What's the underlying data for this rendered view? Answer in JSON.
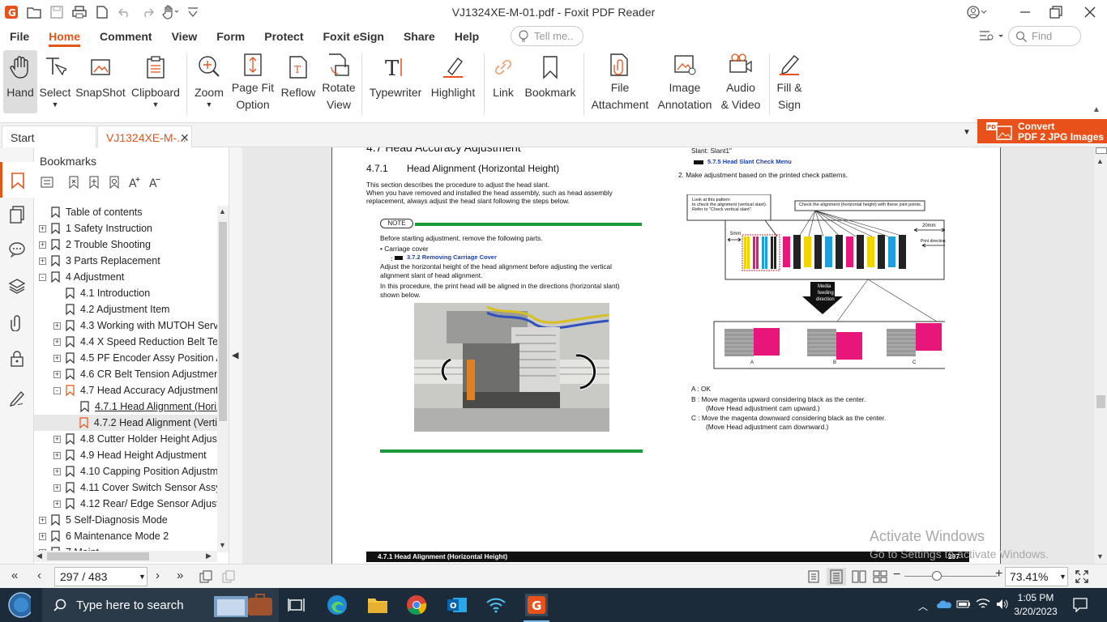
{
  "window": {
    "title": "VJ1324XE-M-01.pdf - Foxit PDF Reader"
  },
  "menu": [
    "File",
    "Home",
    "Comment",
    "View",
    "Form",
    "Protect",
    "Foxit eSign",
    "Share",
    "Help"
  ],
  "menu_active": "Home",
  "tell_me": {
    "placeholder": "Tell me.."
  },
  "find": {
    "placeholder": "Find"
  },
  "ribbon": {
    "hand": "Hand",
    "select": "Select",
    "snapshot": "SnapShot",
    "clipboard": "Clipboard",
    "zoom": "Zoom",
    "pagefit1": "Page Fit",
    "pagefit2": "Option",
    "reflow": "Reflow",
    "rotate1": "Rotate",
    "rotate2": "View",
    "typewriter": "Typewriter",
    "highlight": "Highlight",
    "link": "Link",
    "bookmark": "Bookmark",
    "file1": "File",
    "file2": "Attachment",
    "image1": "Image",
    "image2": "Annotation",
    "audio1": "Audio",
    "audio2": "& Video",
    "fill1": "Fill &",
    "fill2": "Sign"
  },
  "tabs": {
    "start": "Start",
    "doc": "VJ1324XE-M-..."
  },
  "convert": {
    "line1": "Convert",
    "line2": "PDF 2 JPG Images"
  },
  "bookmarks": {
    "title": "Bookmarks",
    "items": [
      {
        "label": "Table of contents",
        "level": 0,
        "exp": ""
      },
      {
        "label": "1 Safety Instruction",
        "level": 0,
        "exp": "+"
      },
      {
        "label": "2 Trouble Shooting",
        "level": 0,
        "exp": "+"
      },
      {
        "label": "3 Parts Replacement",
        "level": 0,
        "exp": "+"
      },
      {
        "label": "4 Adjustment",
        "level": 0,
        "exp": "-"
      },
      {
        "label": "4.1 Introduction",
        "level": 1,
        "exp": ""
      },
      {
        "label": "4.2 Adjustment Item",
        "level": 1,
        "exp": ""
      },
      {
        "label": "4.3 Working with MUTOH Servi",
        "level": 1,
        "exp": "+"
      },
      {
        "label": "4.4 X Speed Reduction Belt Tens",
        "level": 1,
        "exp": "+"
      },
      {
        "label": "4.5 PF Encoder Assy Position Ac",
        "level": 1,
        "exp": "+"
      },
      {
        "label": "4.6 CR Belt Tension Adjustment",
        "level": 1,
        "exp": "+"
      },
      {
        "label": "4.7 Head Accuracy Adjustment",
        "level": 1,
        "exp": "-",
        "orange": true
      },
      {
        "label": "4.7.1 Head Alignment (Horiz",
        "level": 2,
        "exp": "",
        "current": true
      },
      {
        "label": "4.7.2 Head Alignment (Verti",
        "level": 2,
        "exp": "",
        "selected": true,
        "orange": true
      },
      {
        "label": "4.8 Cutter Holder Height Adjust",
        "level": 1,
        "exp": "+"
      },
      {
        "label": "4.9 Head Height Adjustment",
        "level": 1,
        "exp": "+"
      },
      {
        "label": "4.10 Capping Position Adjustme",
        "level": 1,
        "exp": "+"
      },
      {
        "label": "4.11 Cover Switch Sensor Assy P",
        "level": 1,
        "exp": "+"
      },
      {
        "label": "4.12 Rear/ Edge Sensor Adjustm",
        "level": 1,
        "exp": "+"
      },
      {
        "label": "5 Self-Diagnosis Mode",
        "level": 0,
        "exp": "+"
      },
      {
        "label": "6 Maintenance Mode 2",
        "level": 0,
        "exp": "+"
      },
      {
        "label": "7 Maint",
        "level": 0,
        "exp": "+"
      }
    ]
  },
  "doc": {
    "top_heading": "4.7     Head Accuracy Adjustment",
    "section_num": "4.7.1",
    "section_title": "Head Alignment (Horizontal Height)",
    "intro1": "This section describes the procedure to adjust the head slant.",
    "intro2": "When you have removed and installed the head assembly, such as head assembly",
    "intro3": "replacement, always adjust the head slant following the steps below.",
    "note_label": "NOTE",
    "note1": "Before starting adjustment, remove the following parts.",
    "note2": "•   Carriage cover",
    "note3": "3.7.2 Removing Carriage Cover",
    "note4": "Adjust the horizontal height of the head alignment before adjusting the vertical",
    "note5": "alignment slant of head alignment.",
    "note6": "In this procedure, the print head will be aligned in the directions (horizontal slant)",
    "note7": "shown below.",
    "r_slant": "Slant: Slant1\"",
    "r_link": "5.7.5 Head Slant Check Menu",
    "r_step": "2.   Make adjustment based on the printed check patterns.",
    "fig_look1": "Look at this pattern",
    "fig_look2": "to check the alignment (vertical slant).",
    "fig_look3": "Refer to \"Check vertical slant\".",
    "fig_check": "Check the alignment (horizontal height) with these joint points.",
    "fig_5mm": "5mm",
    "fig_20mm": "20mm",
    "fig_printdir": "Print direction",
    "fig_media1": "Media",
    "fig_media2": "feeding",
    "fig_media3": "direction",
    "fig_a": "A",
    "fig_b": "B",
    "fig_c": "C",
    "res_a": "A :  OK",
    "res_b1": "B :  Move magenta upward considering black as the center.",
    "res_b2": "(Move Head adjustment cam upward.)",
    "res_c1": "C :  Move the magenta downward considering black as the center.",
    "res_c2": "(Move Head adjustment cam downward.)",
    "footer_title": "4.7.1 Head Alignment (Horizontal Height)",
    "footer_page": "297"
  },
  "watermark": {
    "line1": "Activate Windows",
    "line2": "Go to Settings to activate Windows."
  },
  "status": {
    "page": "297 / 483",
    "zoom": "73.41%"
  },
  "taskbar": {
    "search_placeholder": "Type here to search",
    "time": "1:05 PM",
    "date": "3/20/2023"
  },
  "colors": {
    "accent": "#e2561a",
    "convert": "#e8511a",
    "link": "#1a3fa8",
    "green_rule": "#1a9a3a",
    "magenta": "#e8157a"
  }
}
